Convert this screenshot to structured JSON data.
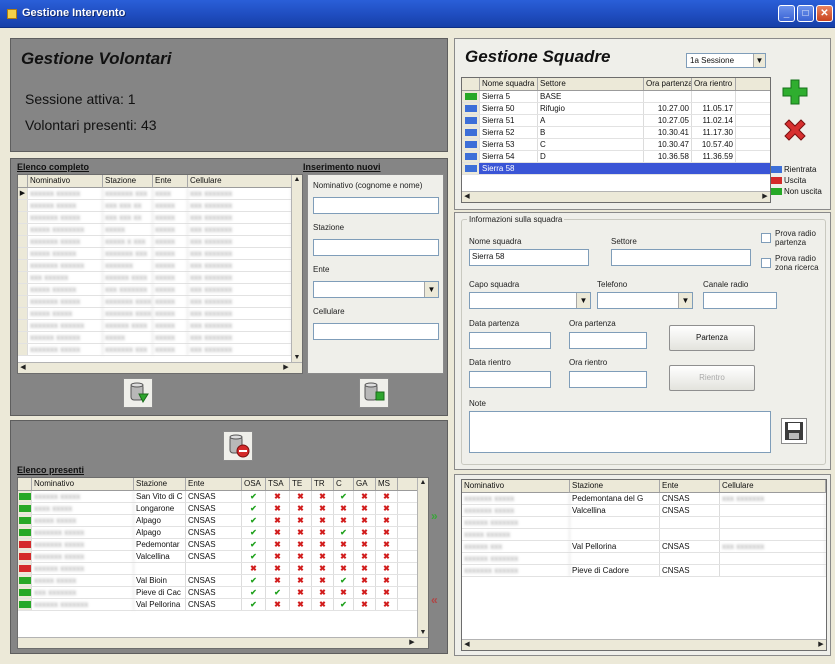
{
  "window": {
    "title": "Gestione Intervento"
  },
  "volontari": {
    "heading": "Gestione Volontari",
    "session_line": "Sessione attiva: 1",
    "present_line": "Volontari presenti: 43"
  },
  "elenco_completo": {
    "title": "Elenco completo",
    "columns": [
      "Nominativo",
      "Stazione",
      "Ente",
      "Cellulare"
    ],
    "rows": [
      [
        "xxxxxx xxxxxx",
        "xxxxxxx xxx",
        "xxxx",
        "xxx xxxxxxx"
      ],
      [
        "xxxxxx xxxxx",
        "xxx xxx xx",
        "xxxxx",
        "xxx xxxxxxx"
      ],
      [
        "xxxxxxx xxxxx",
        "xxx xxx xx",
        "xxxxx",
        "xxx xxxxxxx"
      ],
      [
        "xxxxx xxxxxxxx",
        "xxxxx",
        "xxxxx",
        "xxx xxxxxxx"
      ],
      [
        "xxxxxxx xxxxx",
        "xxxxx x xxx",
        "xxxxx",
        "xxx xxxxxxx"
      ],
      [
        "xxxxx xxxxxx",
        "xxxxxxx xxx",
        "xxxxx",
        "xxx xxxxxxx"
      ],
      [
        "xxxxxxx xxxxxx",
        "xxxxxxx",
        "xxxxx",
        "xxx xxxxxxx"
      ],
      [
        "xxx xxxxxx",
        "xxxxxx xxxx",
        "xxxxx",
        "xxx xxxxxxx"
      ],
      [
        "xxxxx xxxxxx",
        "xxx xxxxxxx",
        "xxxxx",
        "xxx xxxxxxx"
      ],
      [
        "xxxxxxx xxxxx",
        "xxxxxxx xxxx",
        "xxxxx",
        "xxx xxxxxxx"
      ],
      [
        "xxxxx xxxxx",
        "xxxxxxx xxxx",
        "xxxxx",
        "xxx xxxxxxx"
      ],
      [
        "xxxxxxx xxxxxx",
        "xxxxxx xxxx",
        "xxxxx",
        "xxx xxxxxxx"
      ],
      [
        "xxxxxx xxxxxx",
        "xxxxx",
        "xxxxx",
        "xxx xxxxxxx"
      ],
      [
        "xxxxxxx xxxxx",
        "xxxxxxx xxx",
        "xxxxx",
        "xxx xxxxxxx"
      ]
    ]
  },
  "inserimento": {
    "title": "Inserimento nuovi",
    "nominativo_label": "Nominativo (cognome e nome)",
    "stazione_label": "Stazione",
    "ente_label": "Ente",
    "cellulare_label": "Cellulare"
  },
  "elenco_presenti": {
    "title": "Elenco presenti",
    "columns": [
      "Nominativo",
      "Stazione",
      "Ente",
      "OSA",
      "TSA",
      "TE",
      "TR",
      "C",
      "GA",
      "MS"
    ],
    "rows": [
      {
        "status": "green",
        "nome": "xxxxxx xxxxx",
        "stazione": "San Vito di C",
        "ente": "CNSAS",
        "checks": "ok,ko,ko,ko,ok,ko,ko"
      },
      {
        "status": "green",
        "nome": "xxxx xxxxx",
        "stazione": "Longarone",
        "ente": "CNSAS",
        "checks": "ok,ko,ko,ko,ko,ko,ko"
      },
      {
        "status": "green",
        "nome": "xxxxx xxxxx",
        "stazione": "Alpago",
        "ente": "CNSAS",
        "checks": "ok,ko,ko,ko,ko,ko,ko"
      },
      {
        "status": "green",
        "nome": "xxxxxxx xxxxx",
        "stazione": "Alpago",
        "ente": "CNSAS",
        "checks": "ok,ko,ko,ko,ok,ko,ko"
      },
      {
        "status": "red",
        "nome": "xxxxxxx xxxxx",
        "stazione": "Pedemontar",
        "ente": "CNSAS",
        "checks": "ok,ko,ko,ko,ko,ko,ko"
      },
      {
        "status": "red",
        "nome": "xxxxxxx xxxxx",
        "stazione": "Valcellina",
        "ente": "CNSAS",
        "checks": "ok,ko,ko,ko,ko,ko,ko"
      },
      {
        "status": "red",
        "nome": "xxxxxx xxxxxx",
        "stazione": "",
        "ente": "",
        "checks": "ko,ko,ko,ko,ko,ko,ko"
      },
      {
        "status": "green",
        "nome": "xxxxx xxxxx",
        "stazione": "Val Bioin",
        "ente": "CNSAS",
        "checks": "ok,ko,ko,ko,ok,ko,ko"
      },
      {
        "status": "green",
        "nome": "xxx xxxxxxx",
        "stazione": "Pieve di Cac",
        "ente": "CNSAS",
        "checks": "ok,ok,ko,ko,ko,ko,ko"
      },
      {
        "status": "green",
        "nome": "xxxxxx xxxxxxx",
        "stazione": "Val Pellorina",
        "ente": "CNSAS",
        "checks": "ok,ko,ko,ko,ok,ko,ko"
      }
    ]
  },
  "squadre": {
    "heading": "Gestione Squadre",
    "session_select": "1a Sessione",
    "columns": [
      "Nome squadra",
      "Settore",
      "Ora partenza",
      "Ora rientro"
    ],
    "rows": [
      {
        "status": "green",
        "nome": "Sierra 5",
        "settore": "BASE",
        "partenza": "",
        "rientro": ""
      },
      {
        "status": "blue",
        "nome": "Sierra 50",
        "settore": "Rifugio",
        "partenza": "10.27.00",
        "rientro": "11.05.17"
      },
      {
        "status": "blue",
        "nome": "Sierra 51",
        "settore": "A",
        "partenza": "10.27.05",
        "rientro": "11.02.14"
      },
      {
        "status": "blue",
        "nome": "Sierra 52",
        "settore": "B",
        "partenza": "10.30.41",
        "rientro": "11.17.30"
      },
      {
        "status": "blue",
        "nome": "Sierra 53",
        "settore": "C",
        "partenza": "10.30.47",
        "rientro": "10.57.40"
      },
      {
        "status": "blue",
        "nome": "Sierra 54",
        "settore": "D",
        "partenza": "10.36.58",
        "rientro": "11.36.59"
      },
      {
        "status": "blue",
        "nome": "Sierra 58",
        "settore": "",
        "partenza": "",
        "rientro": "",
        "selected": true
      }
    ],
    "legend": {
      "rientrata": "Rientrata",
      "uscita": "Uscita",
      "non_uscita": "Non uscita"
    },
    "colors": {
      "green": "#27a827",
      "blue": "#3d6fd8",
      "red": "#d42a2a"
    }
  },
  "info_squadra": {
    "title": "Informazioni sulla squadra",
    "nome_label": "Nome squadra",
    "nome_value": "Sierra 58",
    "settore_label": "Settore",
    "prova_partenza": "Prova radio partenza",
    "prova_zona": "Prova radio zona ricerca",
    "capo_label": "Capo squadra",
    "telefono_label": "Telefono",
    "canale_label": "Canale radio",
    "data_partenza_label": "Data partenza",
    "ora_partenza_label": "Ora partenza",
    "partenza_button": "Partenza",
    "data_rientro_label": "Data rientro",
    "ora_rientro_label": "Ora rientro",
    "rientro_button": "Rientro",
    "note_label": "Note"
  },
  "membri": {
    "columns": [
      "Nominativo",
      "Stazione",
      "Ente",
      "Cellulare"
    ],
    "rows": [
      [
        "xxxxxxx xxxxx",
        "Pedemontana del G",
        "CNSAS",
        "xxx xxxxxxx"
      ],
      [
        "xxxxxxx xxxxx",
        "Valcellina",
        "CNSAS",
        ""
      ],
      [
        "xxxxxx xxxxxxx",
        "",
        "",
        ""
      ],
      [
        "xxxxx xxxxxx",
        "",
        "",
        ""
      ],
      [
        "xxxxxx xxx",
        "Val Pellorina",
        "CNSAS",
        "xxx xxxxxxx"
      ],
      [
        "xxxxxx xxxxxxx",
        "",
        "",
        ""
      ],
      [
        "xxxxxxx xxxxxx",
        "Pieve di Cadore",
        "CNSAS",
        ""
      ]
    ]
  }
}
